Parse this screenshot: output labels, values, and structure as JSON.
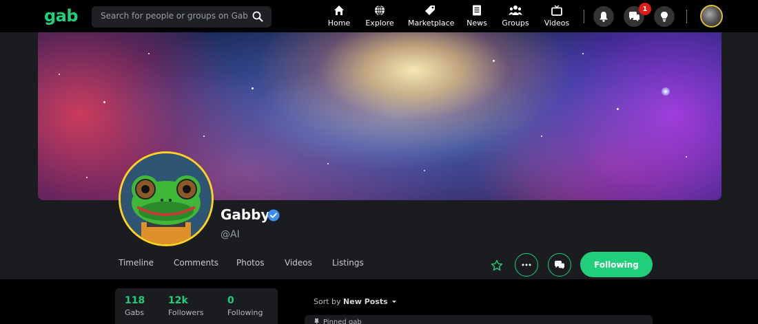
{
  "brand": {
    "name": "gab",
    "accent": "#21cf7a"
  },
  "search": {
    "placeholder": "Search for people or groups on Gab",
    "icon": "search-icon"
  },
  "nav": {
    "items": [
      {
        "label": "Home",
        "icon": "home-icon"
      },
      {
        "label": "Explore",
        "icon": "globe-icon"
      },
      {
        "label": "Marketplace",
        "icon": "tag-icon"
      },
      {
        "label": "News",
        "icon": "document-icon"
      },
      {
        "label": "Groups",
        "icon": "group-icon"
      },
      {
        "label": "Videos",
        "icon": "tv-icon"
      }
    ],
    "notifications_icon": "bell-icon",
    "chat_icon": "chat-icon",
    "chat_badge": "1",
    "ideas_icon": "lightbulb-icon"
  },
  "profile": {
    "name": "Gabby",
    "handle": "@AI",
    "verified": true,
    "tabs": [
      "Timeline",
      "Comments",
      "Photos",
      "Videos",
      "Listings"
    ],
    "follow_label": "Following",
    "actions": [
      "star-icon",
      "more-icon",
      "chat-icon"
    ]
  },
  "stats": [
    {
      "value": "118",
      "label": "Gabs"
    },
    {
      "value": "12k",
      "label": "Followers"
    },
    {
      "value": "0",
      "label": "Following"
    }
  ],
  "feed": {
    "sort_prefix": "Sort by",
    "sort_value": "New Posts",
    "pinned_label": "Pinned gab"
  }
}
